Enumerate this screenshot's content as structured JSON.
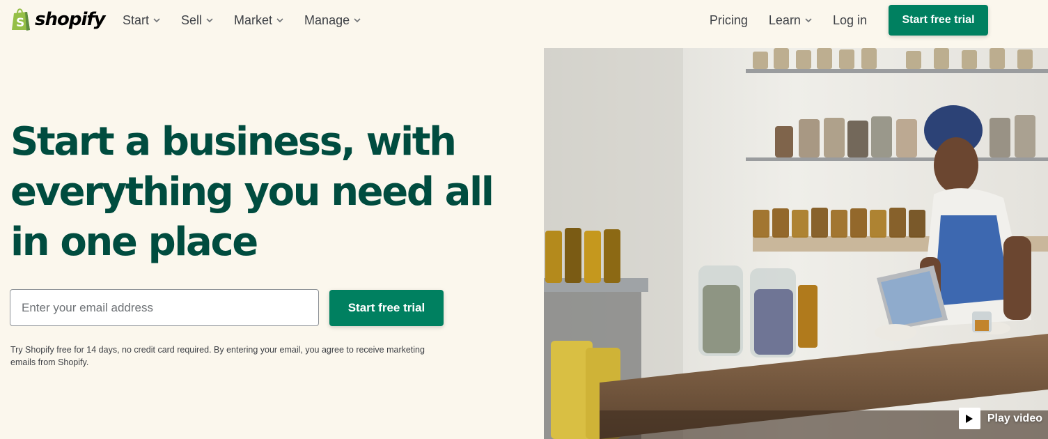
{
  "brand": {
    "name": "shopify",
    "color": "#95bf47"
  },
  "nav": {
    "left_items": [
      {
        "label": "Start",
        "icon": "chevron-down-icon"
      },
      {
        "label": "Sell",
        "icon": "chevron-down-icon"
      },
      {
        "label": "Market",
        "icon": "chevron-down-icon"
      },
      {
        "label": "Manage",
        "icon": "chevron-down-icon"
      }
    ],
    "pricing": "Pricing",
    "learn": "Learn",
    "login": "Log in",
    "cta": "Start free trial"
  },
  "hero": {
    "headline": "Start a business, with everything you need all in one place",
    "email_placeholder": "Enter your email address",
    "email_value": "",
    "cta": "Start free trial",
    "disclaimer": "Try Shopify free for 14 days, no credit card required. By entering your email, you agree to receive marketing emails from Shopify.",
    "play_label": "Play video",
    "play_icon": "play-icon"
  },
  "colors": {
    "accent": "#008060",
    "headline": "#004c3f",
    "background": "#fbf7ed"
  }
}
